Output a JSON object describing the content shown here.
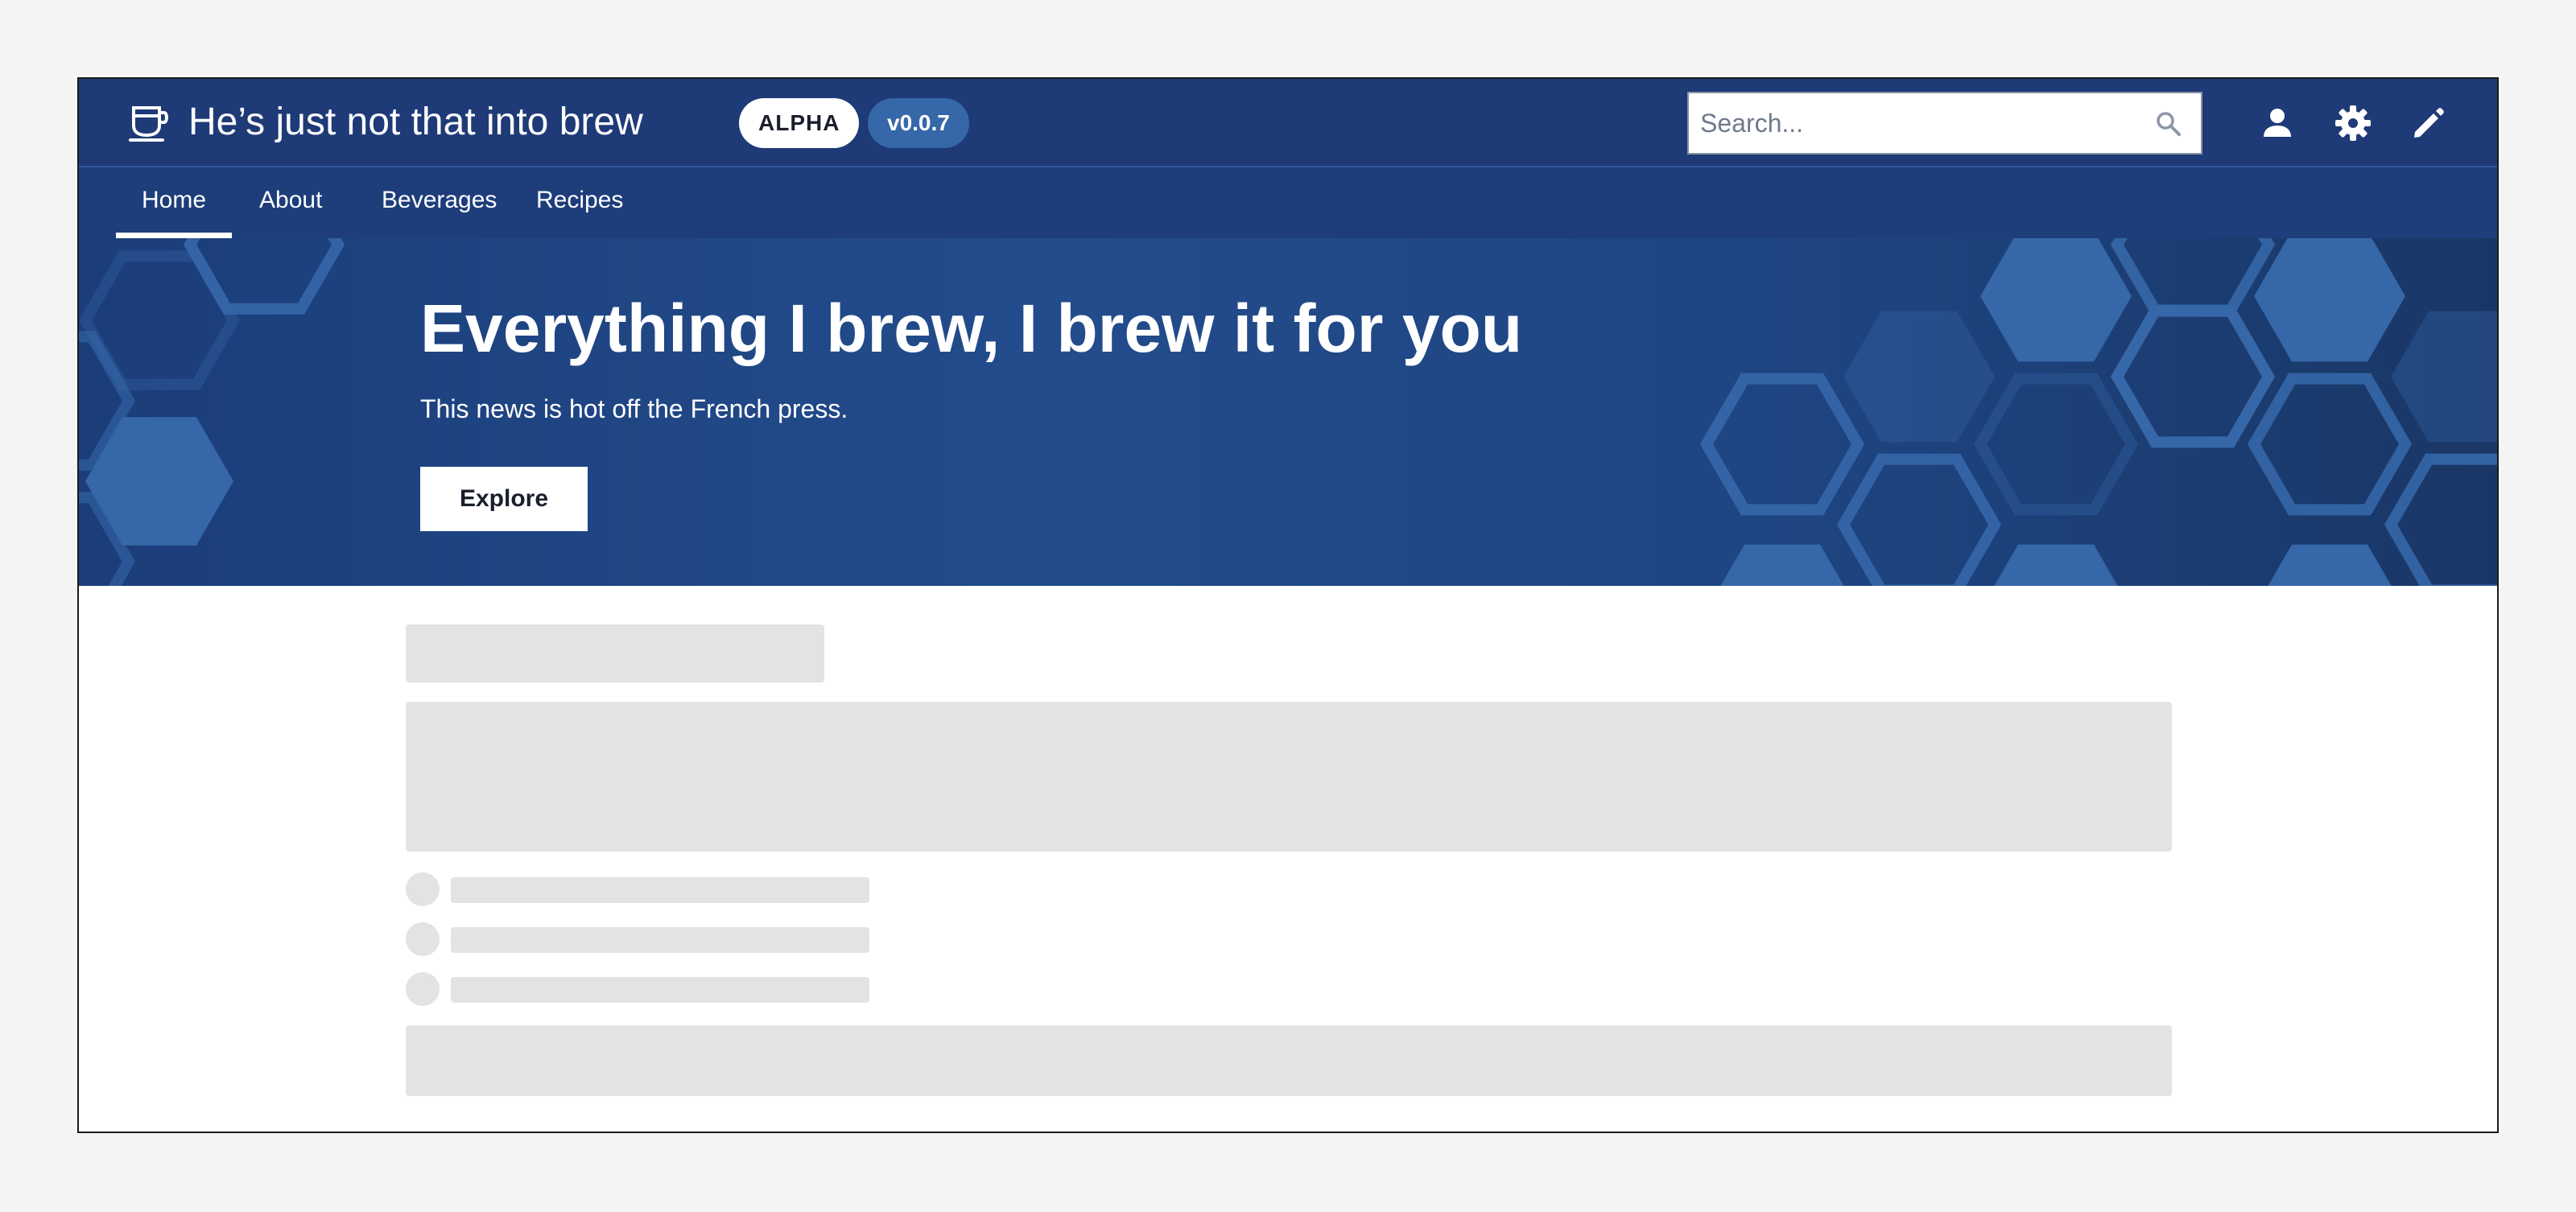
{
  "header": {
    "site_title": "He’s just not that into brew",
    "alpha_tag": "ALPHA",
    "version_tag": "v0.0.7",
    "search_placeholder": "Search...",
    "icons": [
      "coffee-cup-icon",
      "search-icon",
      "user-icon",
      "gear-icon",
      "pencil-icon"
    ]
  },
  "nav": {
    "items": [
      {
        "label": "Home",
        "active": true
      },
      {
        "label": "About",
        "active": false
      },
      {
        "label": "Beverages",
        "active": false
      },
      {
        "label": "Recipes",
        "active": false
      }
    ]
  },
  "hero": {
    "title": "Everything I brew, I brew it for you",
    "subtitle": "This news is hot off the French press.",
    "button_label": "Explore"
  },
  "colors": {
    "header_bg": "#1e3a77",
    "nav_bg": "#1e3d7b",
    "hero_bg": "#234c8c",
    "hex_accent": "#3667a8",
    "skeleton": "#e2e3e5"
  }
}
